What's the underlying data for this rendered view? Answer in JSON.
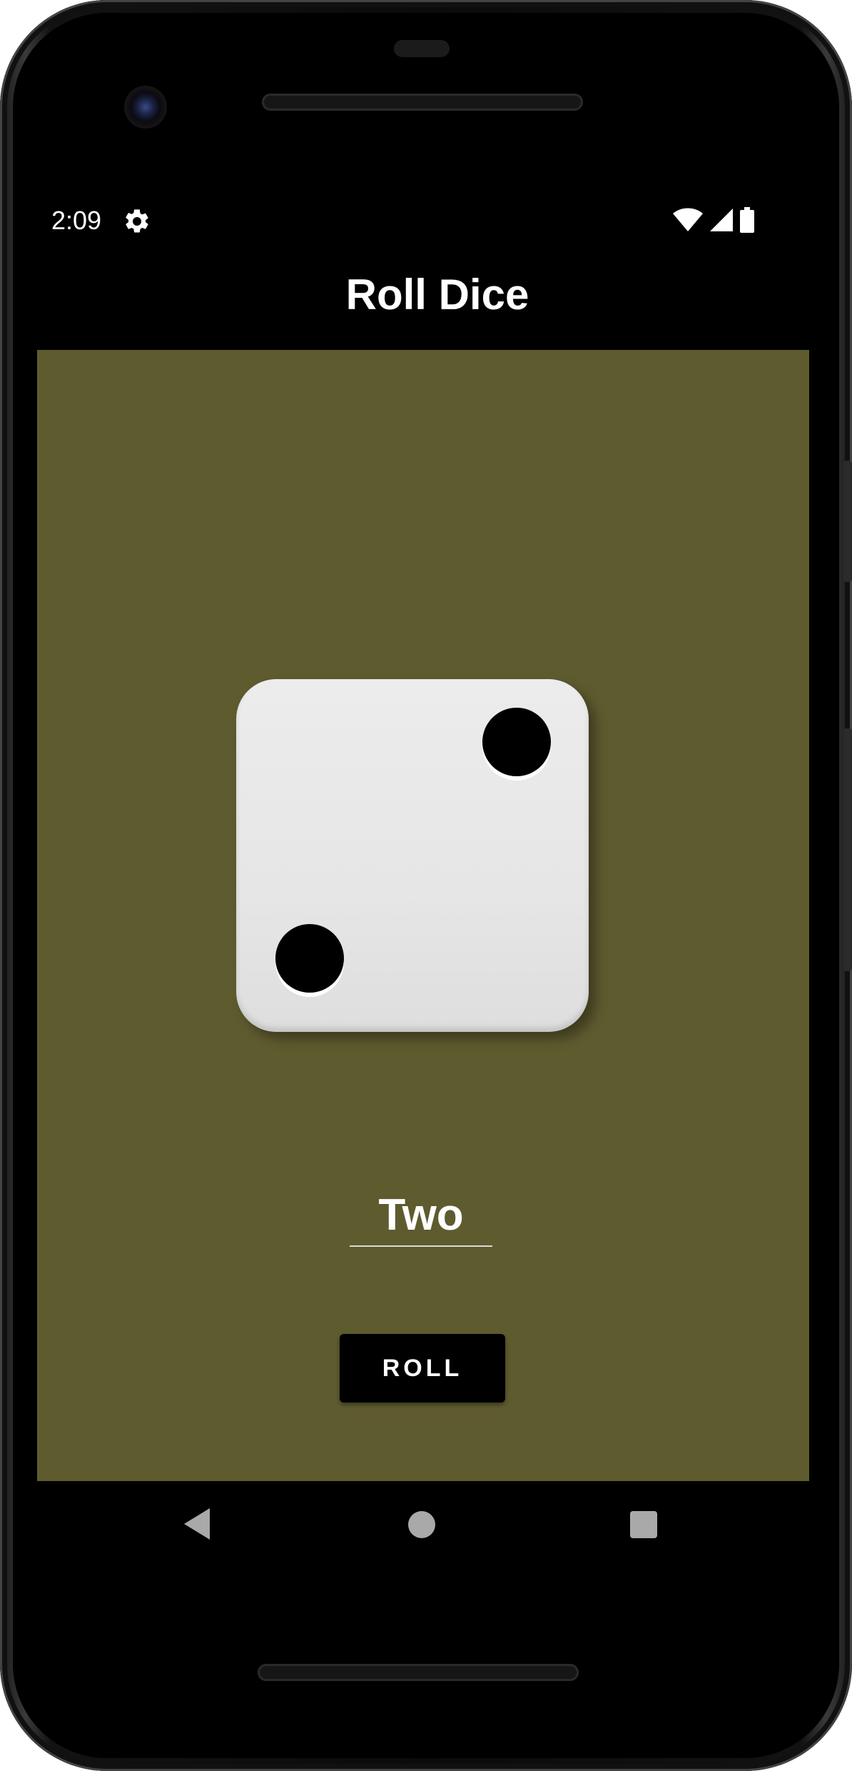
{
  "status_bar": {
    "time": "2:09",
    "settings_icon": "gear-icon",
    "wifi_icon": "wifi-icon",
    "signal_icon": "signal-icon",
    "battery_icon": "battery-icon"
  },
  "app_bar": {
    "title": "Roll Dice"
  },
  "main": {
    "background_color": "#5e5b2f",
    "die": {
      "face_value": 2,
      "pips": 2
    },
    "result_text": "Two",
    "roll_button_label": "ROLL"
  },
  "nav_bar": {
    "back_icon": "back-triangle-icon",
    "home_icon": "home-circle-icon",
    "recents_icon": "recents-square-icon"
  }
}
